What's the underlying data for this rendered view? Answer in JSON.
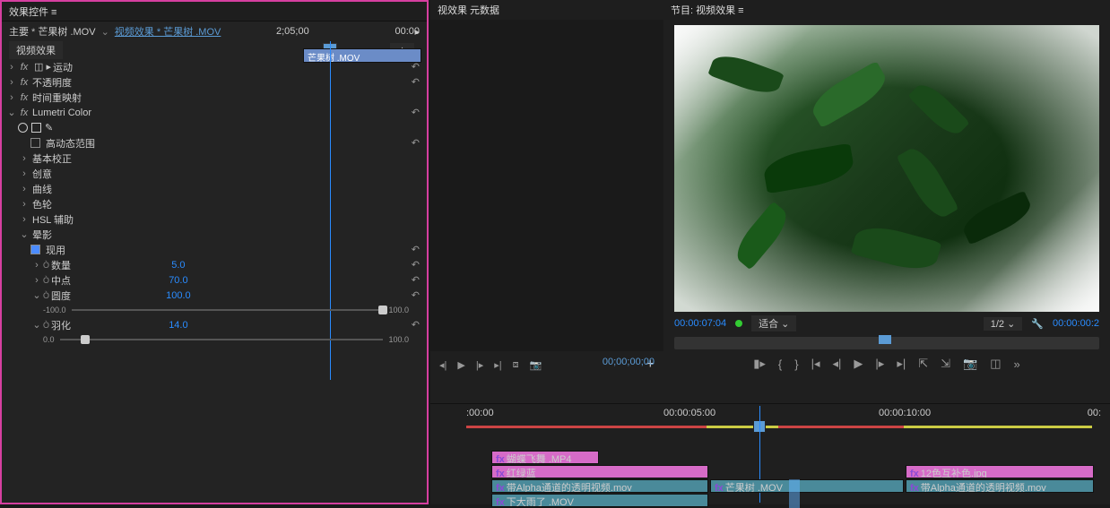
{
  "left": {
    "title": "效果控件  ≡",
    "primary_prefix": "主要",
    "primary_clip": "芒果树 .MOV",
    "crumb": "视频效果 * 芒果树 .MOV",
    "tab": "视频效果",
    "mini_tl": {
      "start": "2;05;00",
      "end": "00:00",
      "clip": "芒果树 .MOV"
    },
    "reset_glyph": "↶",
    "fx": {
      "motion": "运动",
      "opacity": "不透明度",
      "remap": "时间重映射",
      "lumetri": "Lumetri Color",
      "hdr": "高动态范围",
      "basic": "基本校正",
      "creative": "创意",
      "curves": "曲线",
      "wheels": "色轮",
      "hsl": "HSL 辅助",
      "vignette": "晕影",
      "enable": "现用",
      "amount": {
        "label": "数量",
        "value": "5.0"
      },
      "mid": {
        "label": "中点",
        "value": "70.0"
      },
      "round": {
        "label": "圆度",
        "value": "100.0"
      },
      "slider1": {
        "min": "-100.0",
        "max": "100.0",
        "pos": 100
      },
      "feather": {
        "label": "羽化",
        "value": "14.0"
      },
      "slider2": {
        "min": "0.0",
        "max": "100.0",
        "pos": 8
      },
      "stop_glyph": "Ò"
    }
  },
  "center": {
    "tabs": "视效果      元数据",
    "tc": "00;00;00;00"
  },
  "right": {
    "title": "节目: 视频效果  ≡",
    "tc": "00:00:07:04",
    "fit": "适合",
    "zoom": "1/2",
    "tc2": "00:00:00:2"
  },
  "timeline": {
    "marks": [
      ":00:00",
      "00:00:05:00",
      "00:00:10:00",
      "00:"
    ],
    "clips": {
      "v4": "蝴蝶飞舞 .MP4",
      "v3a": "红绿蓝",
      "v3b": "12色互补色.jpg",
      "v2a": "带Alpha通道的透明视频.mov",
      "v2b": "芒果树 .MOV",
      "v2c": "带Alpha通道的透明视频.mov",
      "v1": "下大雨了 .MOV"
    }
  }
}
